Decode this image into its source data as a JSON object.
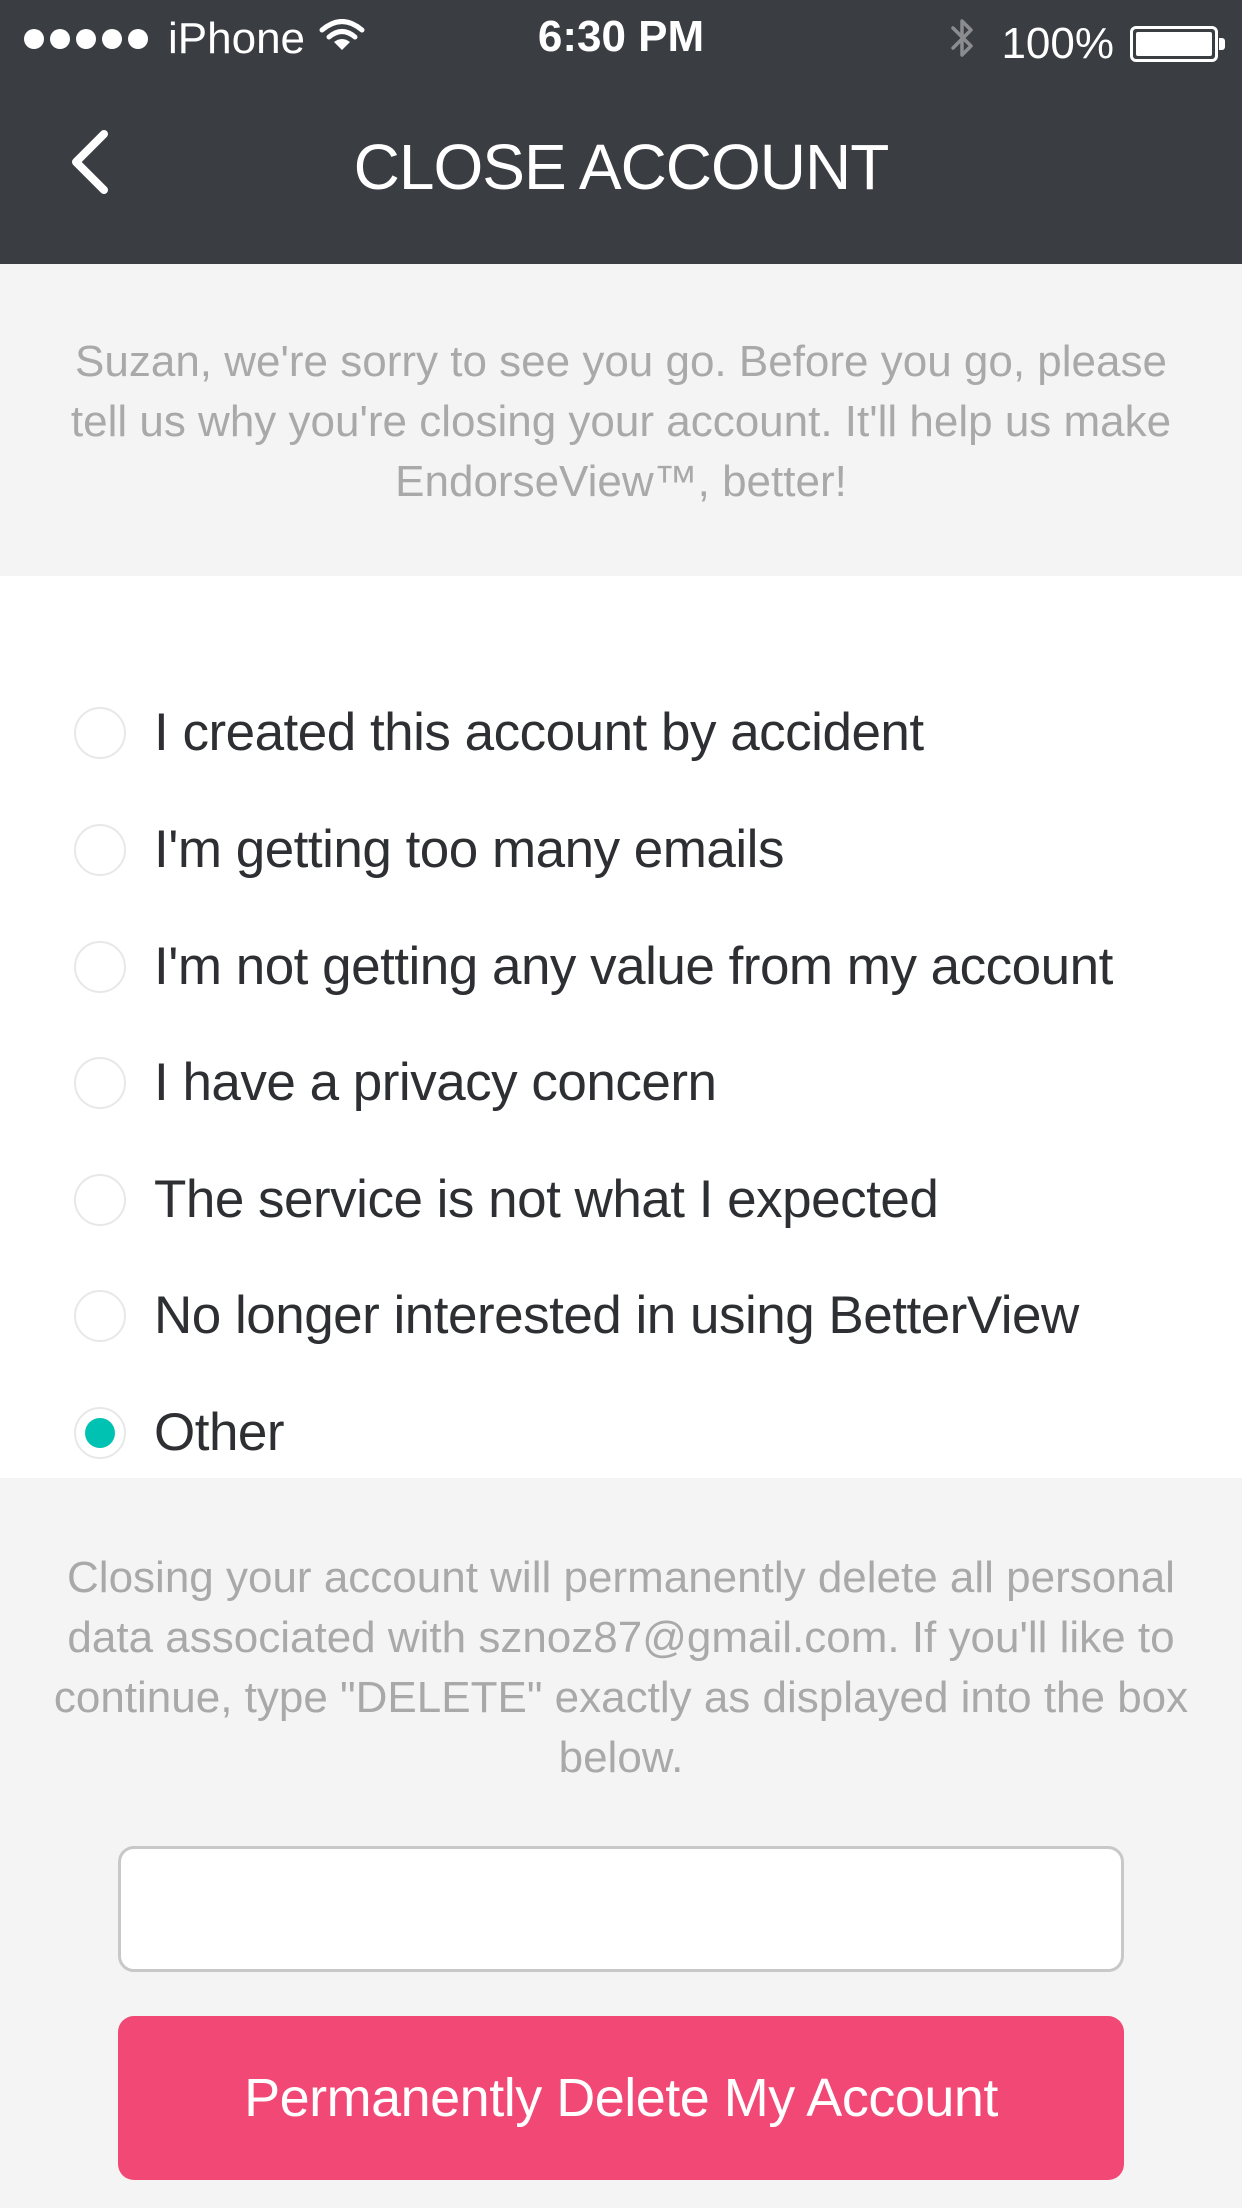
{
  "status_bar": {
    "carrier": "iPhone",
    "time": "6:30 PM",
    "battery": "100%",
    "signal_icon": "signal-dots-icon",
    "wifi_icon": "wifi-icon",
    "bluetooth_icon": "bluetooth-icon",
    "battery_icon": "battery-icon"
  },
  "header": {
    "title": "CLOSE ACCOUNT",
    "back_icon": "chevron-left-icon",
    "background": "#3a3d42"
  },
  "intro": {
    "text": "Suzan, we're sorry to see you go. Before you go, please tell us why you're closing your account. It'll help us make EndorseView™, better!"
  },
  "reasons": {
    "options": [
      {
        "label": "I created this account by accident",
        "selected": false
      },
      {
        "label": "I'm getting too many emails",
        "selected": false
      },
      {
        "label": "I'm not getting any value from my account",
        "selected": false
      },
      {
        "label": "I have a privacy concern",
        "selected": false
      },
      {
        "label": "The service is not what I expected",
        "selected": false
      },
      {
        "label": "No longer interested in using BetterView",
        "selected": false
      },
      {
        "label": "Other",
        "selected": true
      }
    ],
    "selected_color": "#00c2b3"
  },
  "confirm": {
    "text": "Closing your account will permanently delete all personal data associated with sznoz87@gmail.com. If you'll like to continue, type \"DELETE\" exactly as displayed into the box below.",
    "input_value": "",
    "button_label": "Permanently Delete My Account",
    "button_color": "#f24875"
  }
}
